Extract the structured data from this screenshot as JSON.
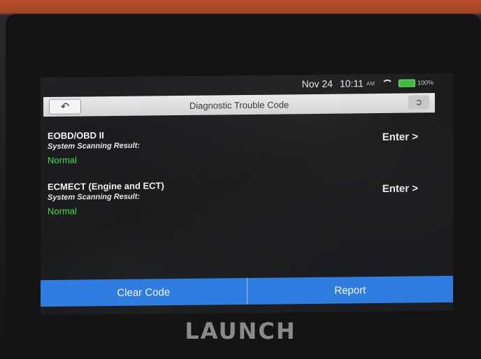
{
  "status_bar": {
    "date": "Nov 24",
    "time": "10:11",
    "ampm": "AM",
    "battery": "100%"
  },
  "header": {
    "title": "Diagnostic Trouble Code",
    "back_icon": "back-arrow-icon",
    "exit_icon": "exit-icon"
  },
  "systems": [
    {
      "name": "EOBD/OBD II",
      "subtitle": "System Scanning Result:",
      "status": "Normal",
      "enter_label": "Enter >"
    },
    {
      "name": "ECMECT (Engine and ECT)",
      "subtitle": "System Scanning Result:",
      "status": "Normal",
      "enter_label": "Enter >"
    }
  ],
  "footer": {
    "clear_code": "Clear Code",
    "report": "Report"
  },
  "device": {
    "brand": "LAUNCH"
  },
  "colors": {
    "accent": "#2f7de0",
    "status_normal": "#3fe04a",
    "bezel_edge": "#a24526"
  }
}
